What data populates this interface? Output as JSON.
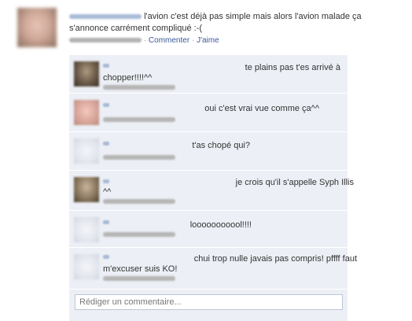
{
  "post": {
    "text": "l'avion c'est déjà pas simple mais alors l'avion malade ça s'annonce carrément compliqué :-(",
    "meta_separator1": "·",
    "comment_link": "Commenter",
    "meta_separator2": "·",
    "like_link": "J'aime"
  },
  "comments": [
    {
      "text_line1": "te plains pas t'es arrivé à",
      "text_line2": "chopper!!!!^^"
    },
    {
      "text_line1": "oui c'est vrai vue comme ça^^",
      "text_line2": ""
    },
    {
      "text_line1": "t'as chopé qui?",
      "text_line2": ""
    },
    {
      "text_line1": "je crois qu'il s'appelle Syph Illis",
      "text_line2": "^^"
    },
    {
      "text_line1": "looooooooool!!!!",
      "text_line2": ""
    },
    {
      "text_line1": "chui trop nulle javais pas compris! pffff faut",
      "text_line2": "m'excuser suis KO!"
    }
  ],
  "comment_box": {
    "placeholder": "Rédiger un commentaire..."
  }
}
